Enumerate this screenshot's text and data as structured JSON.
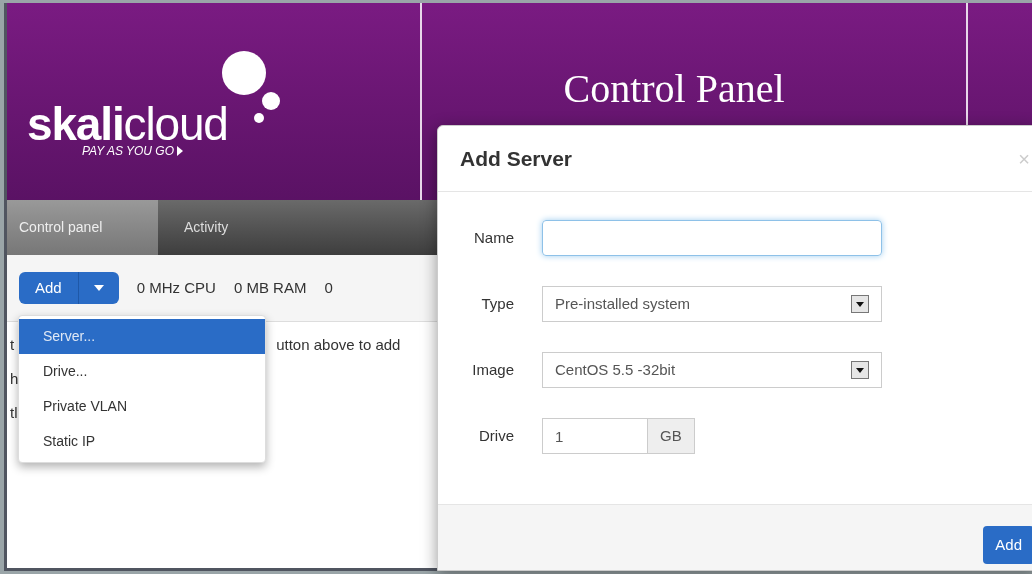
{
  "header": {
    "logo": {
      "bold": "skali",
      "light": "cloud",
      "tagline": "PAY AS YOU GO"
    },
    "title": "Control Panel"
  },
  "nav": {
    "tabs": [
      {
        "label": "Control panel",
        "selected": true
      },
      {
        "label": "Activity",
        "selected": false
      }
    ]
  },
  "toolbar": {
    "add_button": "Add",
    "stats": [
      "0 MHz CPU",
      "0 MB RAM",
      "0"
    ]
  },
  "add_menu": {
    "items": [
      {
        "label": "Server...",
        "selected": true
      },
      {
        "label": "Drive...",
        "selected": false
      },
      {
        "label": "Private VLAN",
        "selected": false
      },
      {
        "label": "Static IP",
        "selected": false
      }
    ]
  },
  "body_lines": [
    {
      "start": "t",
      "end": "utton above to add"
    },
    {
      "start": "h"
    },
    {
      "start": "tl"
    }
  ],
  "dialog": {
    "title": "Add Server",
    "close": "×",
    "fields": [
      {
        "kind": "text",
        "label": "Name",
        "focused": true
      },
      {
        "kind": "select",
        "label": "Type",
        "value": "Pre-installed system"
      },
      {
        "kind": "select",
        "label": "Image",
        "value": "CentOS 5.5 -32bit"
      },
      {
        "kind": "unit",
        "label": "Drive",
        "value": "1",
        "unit": "GB"
      }
    ],
    "primary_button": "Add"
  }
}
